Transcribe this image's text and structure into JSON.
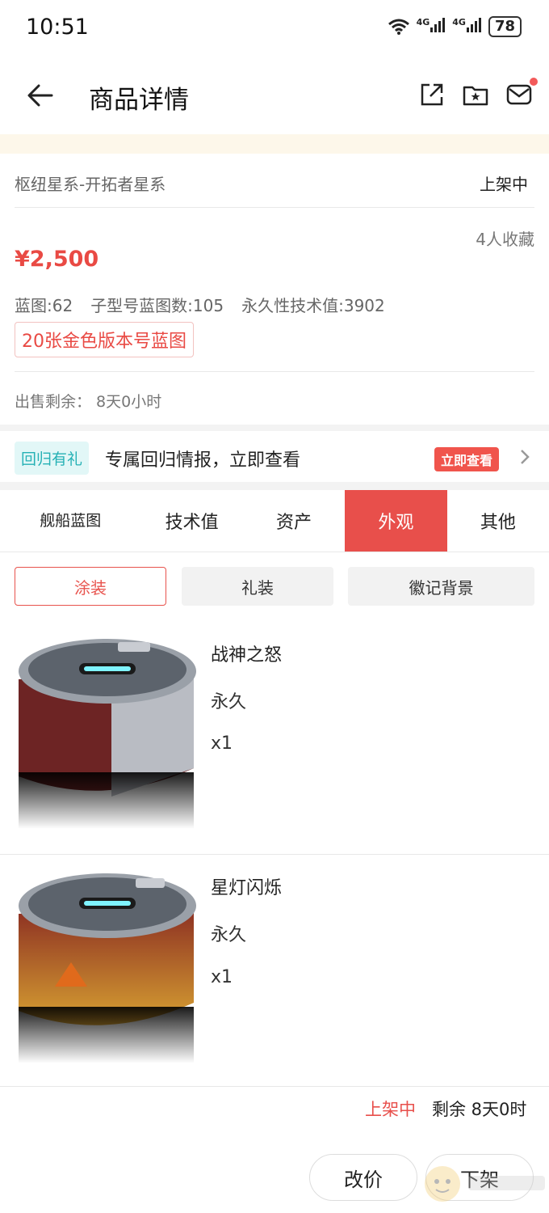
{
  "status_bar": {
    "time": "10:51",
    "net1": "4G",
    "net2": "4G",
    "battery": "78"
  },
  "header": {
    "title": "商品详情"
  },
  "product": {
    "server": "枢纽星系-开拓者星系",
    "status": "上架中",
    "favorites": "4人收藏",
    "price": "¥2,500",
    "specs": [
      "蓝图:62",
      "子型号蓝图数:105",
      "永久性技术值:3902"
    ],
    "tag": "20张金色版本号蓝图",
    "remaining": "出售剩余：  8天0小时"
  },
  "promo": {
    "tag": "回归有礼",
    "text": "专属回归情报，立即查看",
    "button": "立即查看"
  },
  "tabs": [
    {
      "label": "舰船蓝图",
      "active": false
    },
    {
      "label": "技术值",
      "active": false
    },
    {
      "label": "资产",
      "active": false
    },
    {
      "label": "外观",
      "active": true
    },
    {
      "label": "其他",
      "active": false
    }
  ],
  "subtabs": [
    {
      "label": "涂装",
      "selected": true
    },
    {
      "label": "礼装",
      "selected": false
    },
    {
      "label": "徽记背景",
      "selected": false
    }
  ],
  "items": [
    {
      "name": "战神之怒",
      "term": "永久",
      "qty": "x1",
      "accent": "#7d2a2a"
    },
    {
      "name": "星灯闪烁",
      "term": "永久",
      "qty": "x1",
      "accent": "#d39a2c"
    }
  ],
  "bottom": {
    "status": "上架中",
    "remaining": "剩余 8天0时",
    "edit_price": "改价",
    "delist": "下架"
  },
  "colors": {
    "accent": "#e84f4b"
  }
}
